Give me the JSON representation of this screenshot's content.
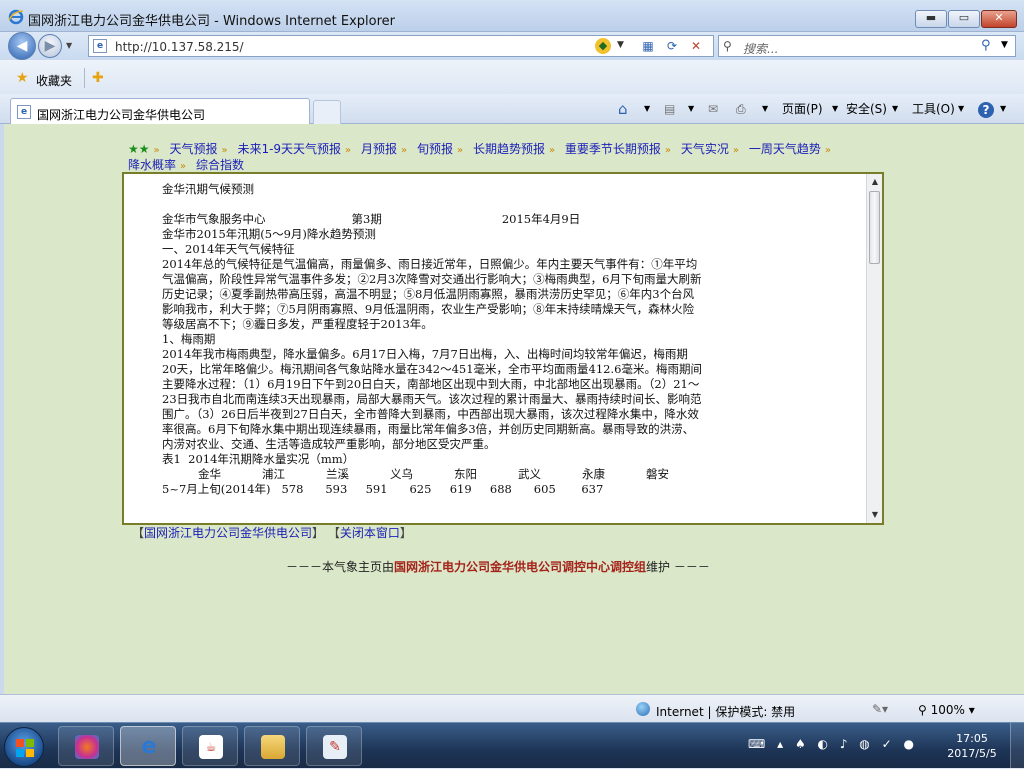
{
  "window": {
    "title": "国网浙江电力公司金华供电公司 - Windows Internet Explorer",
    "min_glyph": "▬",
    "max_glyph": "▭",
    "close_glyph": "✕"
  },
  "address_bar": {
    "url": "http://10.137.58.215/",
    "search_placeholder": "搜索..."
  },
  "favorites_bar": {
    "label": "收藏夹"
  },
  "tab": {
    "title": "国网浙江电力公司金华供电公司"
  },
  "command_bar": {
    "page": "页面(P)",
    "safety": "安全(S)",
    "tools": "工具(O)",
    "help": "?"
  },
  "nav_links": [
    "天气预报",
    "未来1-9天天气预报",
    "月预报",
    "旬预报",
    "长期趋势预报",
    "重要季节长期预报",
    "天气实况",
    "一周天气趋势",
    "降水概率",
    "综合指数"
  ],
  "report": {
    "title": "金华汛期气候预测",
    "org": "金华市气象服务中心",
    "issue": "第3期",
    "date": "2015年4月9日",
    "subtitle": "金华市2015年汛期(5～9月)降水趋势预测",
    "section1": "一、2014年天气气候特征",
    "para1": "2014年总的气候特征是气温偏高，雨量偏多、雨日接近常年，日照偏少。年内主要天气事件有：①年平均气温偏高，阶段性异常气温事件多发；②2月3次降雪对交通出行影响大；③梅雨典型，6月下旬雨量大刷新历史记录；④夏季副热带高压弱，高温不明显；⑤8月低温阴雨寡照，暴雨洪涝历史罕见；⑥年内3个台风影响我市，利大于弊；⑦5月阴雨寡照、9月低温阴雨，农业生产受影响；⑧年末持续晴燥天气，森林火险等级居高不下；⑨霾日多发，严重程度轻于2013年。",
    "sub1": "1、梅雨期",
    "para2": "2014年我市梅雨典型，降水量偏多。6月17日入梅，7月7日出梅，入、出梅时间均较常年偏迟，梅雨期20天，比常年略偏少。梅汛期间各气象站降水量在342～451毫米，全市平均面雨量412.6毫米。梅雨期间主要降水过程：（1）6月19日下午到20日白天，南部地区出现中到大雨，中北部地区出现暴雨。（2）21～23日我市自北而南连续3天出现暴雨，局部大暴雨天气。该次过程的累计雨量大、暴雨持续时间长、影响范围广。（3）26日后半夜到27日白天，全市普降大到暴雨，中西部出现大暴雨，该次过程降水集中，降水效率很高。6月下旬降水集中期出现连续暴雨，雨量比常年偏多3倍，并创历史同期新高。暴雨导致的洪涝、内涝对农业、交通、生活等造成较严重影响，部分地区受灾严重。",
    "table_title": "表1  2014年汛期降水量实况（mm）",
    "table_headers": [
      "金华",
      "浦江",
      "兰溪",
      "义乌",
      "东阳",
      "武义",
      "永康",
      "磐安"
    ],
    "cut_row": "5~7月上旬(2014年)   578      593     591      625     619     688      605       637"
  },
  "bottom_links": {
    "home": "国网浙江电力公司金华供电公司",
    "close": "关闭本窗口",
    "br_open": "【",
    "br_close": "】"
  },
  "footer": {
    "prefix": "－－－本气象主页由",
    "org": "国网浙江电力公司金华供电公司调控中心调控组",
    "suffix": "维护 －－－"
  },
  "status_bar": {
    "zone": "Internet | 保护模式: 禁用",
    "zoom": "100%"
  },
  "taskbar": {
    "time": "17:05",
    "date": "2017/5/5"
  },
  "colors": {
    "content_bg": "#dbe7c9",
    "link": "#1a1fb7",
    "border_olive": "#777d28",
    "footer_org": "#a4231a"
  }
}
